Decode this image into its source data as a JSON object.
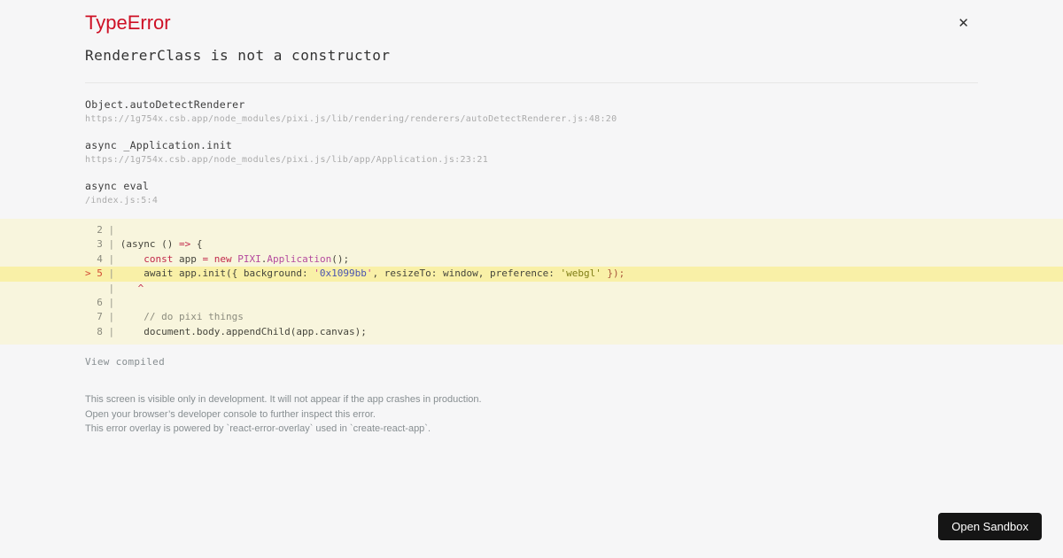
{
  "dialog": {
    "title": "TypeError",
    "close_icon": "✕",
    "message": "RendererClass is not a constructor",
    "stack_frames": [
      {
        "fn": "Object.autoDetectRenderer",
        "location": "https://1g754x.csb.app/node_modules/pixi.js/lib/rendering/renderers/autoDetectRenderer.js:48:20"
      },
      {
        "fn": "async _Application.init",
        "location": "https://1g754x.csb.app/node_modules/pixi.js/lib/app/Application.js:23:21"
      },
      {
        "fn": "async eval",
        "location": "/index.js:5:4"
      }
    ],
    "code_frame": {
      "lines": [
        {
          "num": "2",
          "marked": false,
          "tokens": []
        },
        {
          "num": "3",
          "marked": false,
          "tokens": [
            {
              "c": "plain",
              "t": "(async () "
            },
            {
              "c": "keyword",
              "t": "=>"
            },
            {
              "c": "plain",
              "t": " {"
            }
          ]
        },
        {
          "num": "4",
          "marked": false,
          "tokens": [
            {
              "c": "plain",
              "t": "    "
            },
            {
              "c": "keyword",
              "t": "const"
            },
            {
              "c": "plain",
              "t": " app "
            },
            {
              "c": "keyword",
              "t": "="
            },
            {
              "c": "plain",
              "t": " "
            },
            {
              "c": "keyword",
              "t": "new"
            },
            {
              "c": "plain",
              "t": " "
            },
            {
              "c": "cap",
              "t": "PIXI"
            },
            {
              "c": "plain",
              "t": "."
            },
            {
              "c": "cap",
              "t": "Application"
            },
            {
              "c": "plain",
              "t": "();"
            }
          ]
        },
        {
          "num": "5",
          "marked": true,
          "tokens": [
            {
              "c": "plain",
              "t": "    await app.init({ background: "
            },
            {
              "c": "strq",
              "t": "'"
            },
            {
              "c": "strb",
              "t": "0x1099bb"
            },
            {
              "c": "strq",
              "t": "'"
            },
            {
              "c": "plain",
              "t": ", resizeTo: window, preference: "
            },
            {
              "c": "strg",
              "t": "'webgl'"
            },
            {
              "c": "punct",
              "t": " });"
            }
          ]
        },
        {
          "num": "",
          "marked": false,
          "tokens": [
            {
              "c": "keyword",
              "t": "   ^"
            }
          ]
        },
        {
          "num": "6",
          "marked": false,
          "tokens": []
        },
        {
          "num": "7",
          "marked": false,
          "tokens": [
            {
              "c": "comment",
              "t": "    // do pixi things"
            }
          ]
        },
        {
          "num": "8",
          "marked": false,
          "tokens": [
            {
              "c": "plain",
              "t": "    document.body.appendChild(app.canvas);"
            }
          ]
        }
      ]
    },
    "view_compiled_label": "View compiled",
    "footer_lines": [
      "This screen is visible only in development. It will not appear if the app crashes in production.",
      "Open your browser’s developer console to further inspect this error.",
      "This error overlay is powered by `react-error-overlay` used in `create-react-app`."
    ]
  },
  "open_sandbox": {
    "label": "Open Sandbox"
  },
  "colors": {
    "page_background": "#f6f6f7",
    "error_red": "#ce1126",
    "code_frame_background": "#f8f5dd",
    "highlight_line_background": "#f9f0a7",
    "keyword": "#c2294b",
    "capitalized_identifier": "#b44a9e",
    "string_hex": "#4a54b0",
    "string_webgl": "#7f7d15",
    "secondary_text": "#878e91",
    "button_background": "#151515",
    "button_text": "#ffffff"
  }
}
